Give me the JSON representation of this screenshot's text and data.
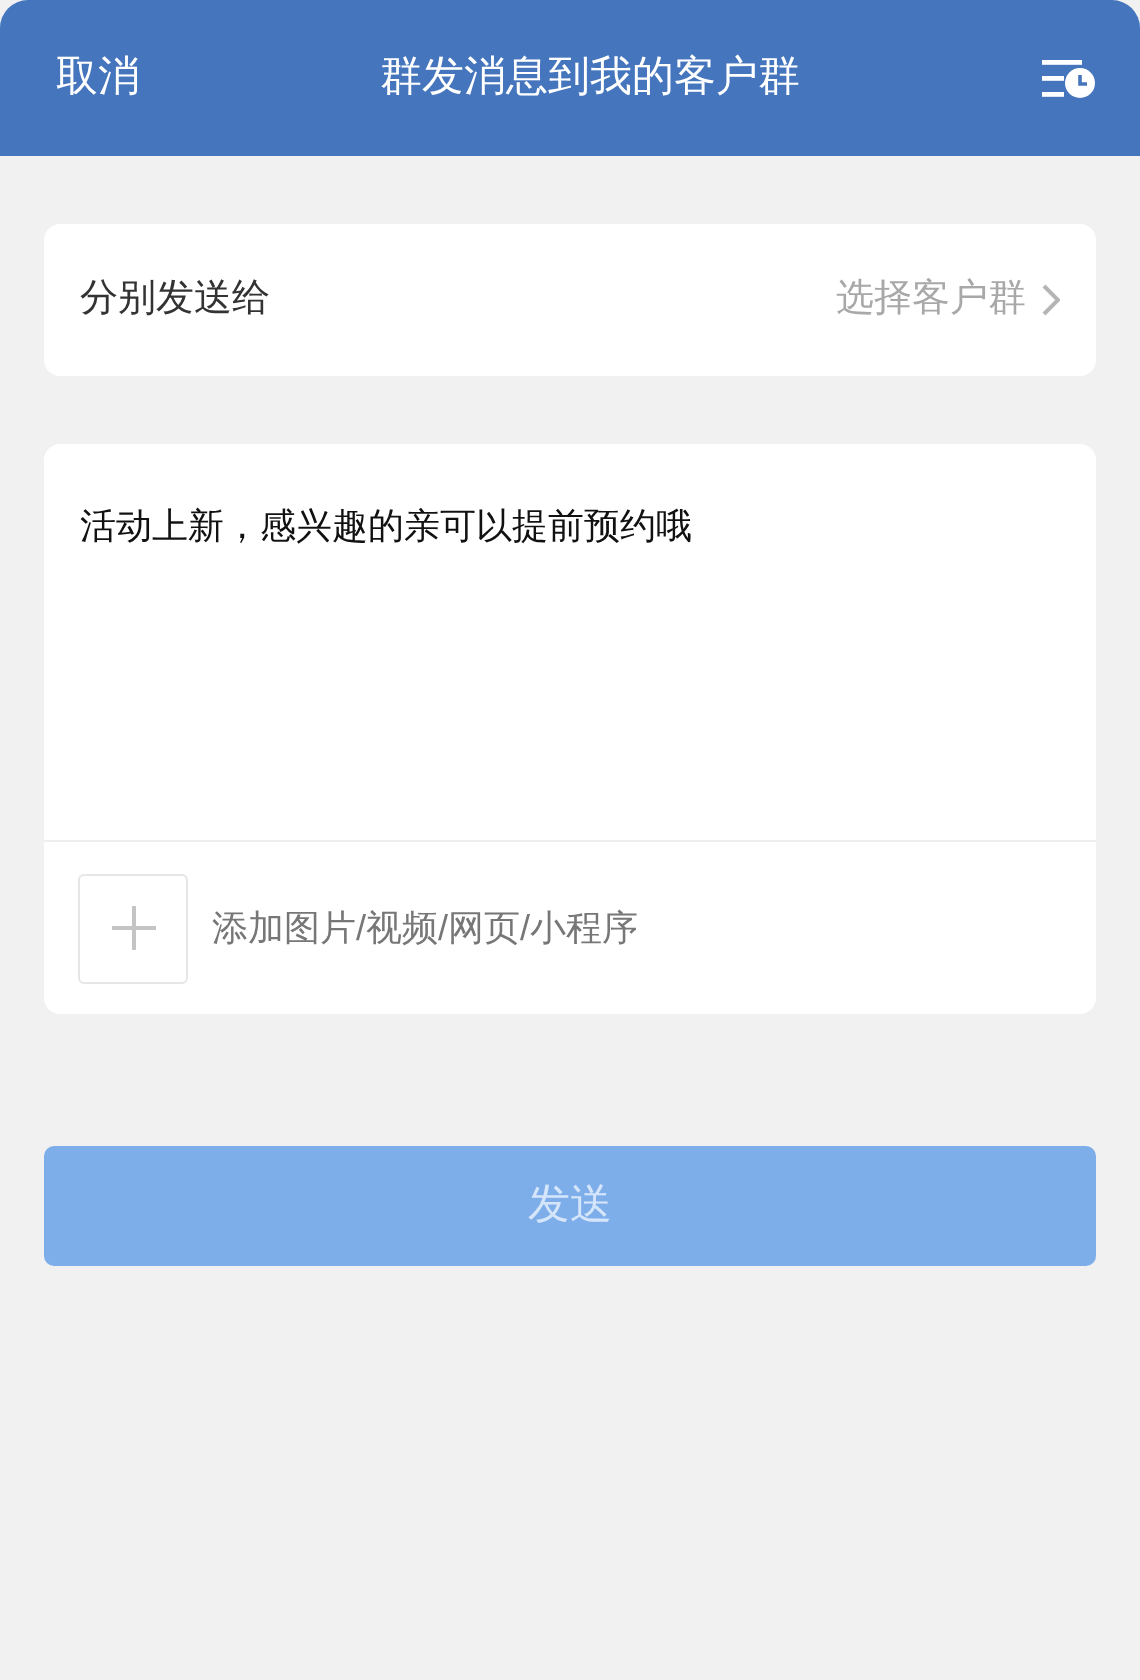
{
  "header": {
    "cancel": "取消",
    "title": "群发消息到我的客户群"
  },
  "recipient": {
    "label": "分别发送给",
    "value": "选择客户群"
  },
  "message": {
    "text": "活动上新，感兴趣的亲可以提前预约哦",
    "attach_label": "添加图片/视频/网页/小程序"
  },
  "send_button": {
    "label": "发送",
    "disabled": true
  }
}
